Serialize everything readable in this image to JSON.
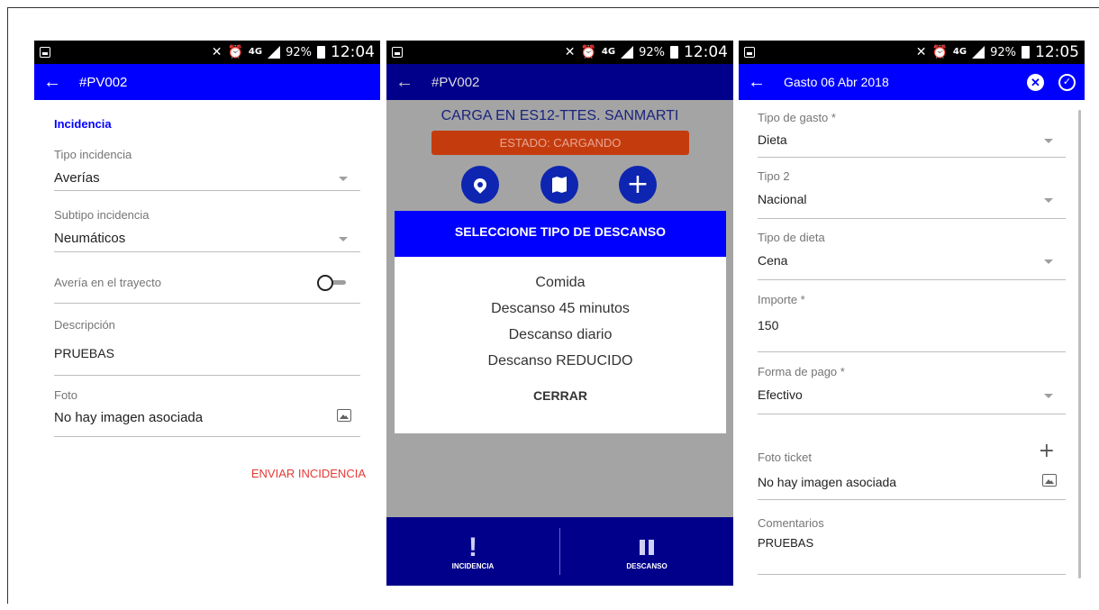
{
  "status_bar": {
    "battery": "92%",
    "network": "4G",
    "time_1": "12:04",
    "time_2": "12:04",
    "time_3": "12:05"
  },
  "screen_incidencia": {
    "header_title": "#PV002",
    "section_title": "Incidencia",
    "tipo_label": "Tipo incidencia",
    "tipo_value": "Averías",
    "subtipo_label": "Subtipo incidencia",
    "subtipo_value": "Neumáticos",
    "trayecto_label": "Avería en el trayecto",
    "descripcion_label": "Descripción",
    "descripcion_value": "PRUEBAS",
    "foto_label": "Foto",
    "foto_value": "No hay imagen asociada",
    "send_label": "ENVIAR INCIDENCIA"
  },
  "screen_descanso": {
    "header_title": "#PV002",
    "load_title": "CARGA EN ES12-TTES. SANMARTI",
    "state_label": "ESTADO: CARGANDO",
    "dialog_title": "SELECCIONE TIPO DE DESCANSO",
    "options": [
      "Comida",
      "Descanso 45 minutos",
      "Descanso diario",
      "Descanso REDUCIDO"
    ],
    "close_label": "CERRAR",
    "nav_incidencia": "INCIDENCIA",
    "nav_descanso": "DESCANSO"
  },
  "screen_gasto": {
    "header_title": "Gasto 06 Abr 2018",
    "tipo_gasto_label": "Tipo de gasto *",
    "tipo_gasto_value": "Dieta",
    "tipo2_label": "Tipo 2",
    "tipo2_value": "Nacional",
    "tipo_dieta_label": "Tipo de dieta",
    "tipo_dieta_value": "Cena",
    "importe_label": "Importe *",
    "importe_value": "150",
    "forma_pago_label": "Forma de pago *",
    "forma_pago_value": "Efectivo",
    "foto_ticket_label": "Foto ticket",
    "foto_ticket_value": "No hay imagen asociada",
    "comentarios_label": "Comentarios",
    "comentarios_value": "PRUEBAS"
  },
  "colors": {
    "primary_blue": "#0000ff",
    "dark_blue": "#00008b",
    "state_orange": "#c43c0e",
    "send_red": "#e53935"
  }
}
